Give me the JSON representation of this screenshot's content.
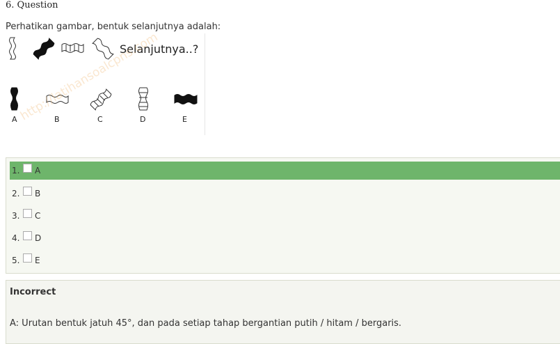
{
  "question": {
    "title": "6. Question",
    "prompt": "Perhatikan gambar, bentuk selanjutnya adalah:"
  },
  "figure": {
    "sequence_caption": "Selanjutnya..?",
    "option_labels": [
      "A",
      "B",
      "C",
      "D",
      "E"
    ],
    "watermark": "http://latihansoalcpns.com"
  },
  "answers": [
    {
      "num": "1.",
      "label": "A",
      "selected": true
    },
    {
      "num": "2.",
      "label": "B",
      "selected": false
    },
    {
      "num": "3.",
      "label": "C",
      "selected": false
    },
    {
      "num": "4.",
      "label": "D",
      "selected": false
    },
    {
      "num": "5.",
      "label": "E",
      "selected": false
    }
  ],
  "feedback": {
    "title": "Incorrect",
    "text": "A: Urutan bentuk jatuh 45°, dan pada setiap tahap bergantian putih / hitam / bergaris."
  },
  "colors": {
    "selected_row": "#6eb56b",
    "answers_bg": "#f6f8f2",
    "feedback_bg": "#f4f5f0"
  }
}
